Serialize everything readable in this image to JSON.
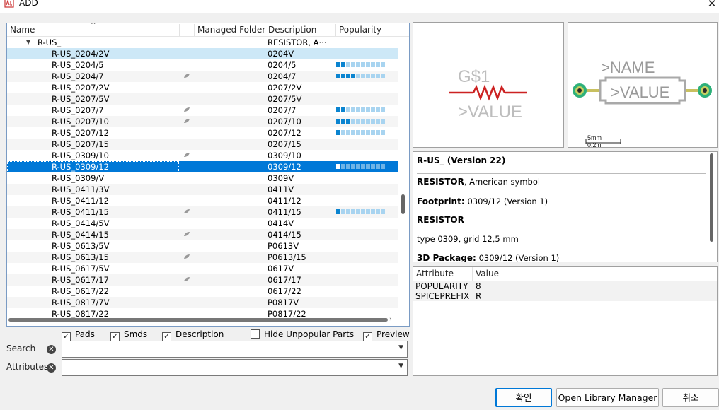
{
  "window": {
    "title": "ADD"
  },
  "tree": {
    "columns": [
      "Name",
      "Managed Folder",
      "Description",
      "Popularity"
    ],
    "group": {
      "name": "R-US_",
      "description": "RESISTOR, A···"
    },
    "rows": [
      {
        "name": "R-US_0204/2V",
        "desc": "0204V",
        "managed": false,
        "pop": 0,
        "state": "hover"
      },
      {
        "name": "R-US_0204/5",
        "desc": "0204/5",
        "managed": false,
        "pop": 2
      },
      {
        "name": "R-US_0204/7",
        "desc": "0204/7",
        "managed": true,
        "pop": 4
      },
      {
        "name": "R-US_0207/2V",
        "desc": "0207/2V",
        "managed": false,
        "pop": 0
      },
      {
        "name": "R-US_0207/5V",
        "desc": "0207/5V",
        "managed": false,
        "pop": 0
      },
      {
        "name": "R-US_0207/7",
        "desc": "0207/7",
        "managed": true,
        "pop": 2
      },
      {
        "name": "R-US_0207/10",
        "desc": "0207/10",
        "managed": true,
        "pop": 3
      },
      {
        "name": "R-US_0207/12",
        "desc": "0207/12",
        "managed": false,
        "pop": 1
      },
      {
        "name": "R-US_0207/15",
        "desc": "0207/15",
        "managed": false,
        "pop": 0
      },
      {
        "name": "R-US_0309/10",
        "desc": "0309/10",
        "managed": true,
        "pop": 0
      },
      {
        "name": "R-US_0309/12",
        "desc": "0309/12",
        "managed": false,
        "pop": 1,
        "state": "selected"
      },
      {
        "name": "R-US_0309/V",
        "desc": "0309V",
        "managed": false,
        "pop": 0
      },
      {
        "name": "R-US_0411/3V",
        "desc": "0411V",
        "managed": false,
        "pop": 0
      },
      {
        "name": "R-US_0411/12",
        "desc": "0411/12",
        "managed": false,
        "pop": 0
      },
      {
        "name": "R-US_0411/15",
        "desc": "0411/15",
        "managed": true,
        "pop": 1
      },
      {
        "name": "R-US_0414/5V",
        "desc": "0414V",
        "managed": false,
        "pop": 0
      },
      {
        "name": "R-US_0414/15",
        "desc": "0414/15",
        "managed": true,
        "pop": 0
      },
      {
        "name": "R-US_0613/5V",
        "desc": "P0613V",
        "managed": false,
        "pop": 0
      },
      {
        "name": "R-US_0613/15",
        "desc": "P0613/15",
        "managed": true,
        "pop": 0
      },
      {
        "name": "R-US_0617/5V",
        "desc": "0617V",
        "managed": false,
        "pop": 0
      },
      {
        "name": "R-US_0617/17",
        "desc": "0617/17",
        "managed": true,
        "pop": 0
      },
      {
        "name": "R-US_0617/22",
        "desc": "0617/22",
        "managed": false,
        "pop": 0
      },
      {
        "name": "R-US_0817/7V",
        "desc": "P0817V",
        "managed": false,
        "pop": 0
      },
      {
        "name": "R-US_0817/22",
        "desc": "P0817/22",
        "managed": false,
        "pop": 0
      }
    ]
  },
  "filters": {
    "pads": "Pads",
    "smds": "Smds",
    "description": "Description",
    "hide_unpopular": "Hide Unpopular Parts",
    "preview": "Preview",
    "pads_checked": true,
    "smds_checked": true,
    "description_checked": true,
    "hide_unpopular_checked": false,
    "preview_checked": true
  },
  "search": {
    "label": "Search",
    "value": ""
  },
  "attributes_filter": {
    "label": "Attributes",
    "value": ""
  },
  "symbol_preview": {
    "name": "G$1",
    "value": ">VALUE"
  },
  "package_preview": {
    "name": ">NAME",
    "value": ">VALUE",
    "scale_mm": "5mm",
    "scale_in": "0.2in"
  },
  "info": {
    "title": "R-US_ (Version 22)",
    "desc_bold": "RESISTOR",
    "desc_rest": ", American symbol",
    "footprint_label": "Footprint:",
    "footprint_value": "0309/12 (Version 1)",
    "section": "RESISTOR",
    "type_line": "type 0309, grid 12,5 mm",
    "package_label": "3D Package:",
    "package_value": "0309/12 (Version 1)"
  },
  "attribute_table": {
    "columns": [
      "Attribute",
      "Value"
    ],
    "rows": [
      {
        "attribute": "POPULARITY",
        "value": "8"
      },
      {
        "attribute": "SPICEPREFIX",
        "value": "R"
      }
    ]
  },
  "buttons": {
    "ok": "확인",
    "open_library_manager": "Open Library Manager",
    "cancel": "취소"
  },
  "colors": {
    "selection": "#0078d7",
    "hover": "#cde8f7",
    "popularity_fill": "#0a84d0",
    "resistor": "#cc2222",
    "pad": "#2db07a"
  }
}
